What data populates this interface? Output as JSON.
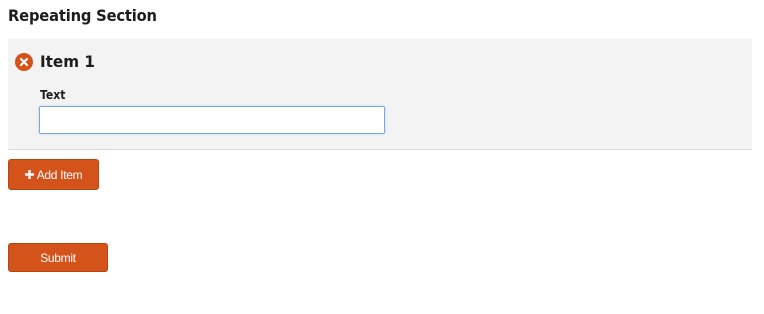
{
  "section": {
    "title": "Repeating Section"
  },
  "items": [
    {
      "title": "Item 1",
      "remove_icon": "remove-circle-icon",
      "fields": [
        {
          "label": "Text",
          "value": "",
          "placeholder": ""
        }
      ]
    }
  ],
  "actions": {
    "add_item_label": "Add Item",
    "add_item_icon": "plus-icon",
    "submit_label": "Submit"
  },
  "colors": {
    "accent": "#d4531b",
    "item_background": "#f3f3f3",
    "input_focus_border": "#7aa7e0"
  }
}
